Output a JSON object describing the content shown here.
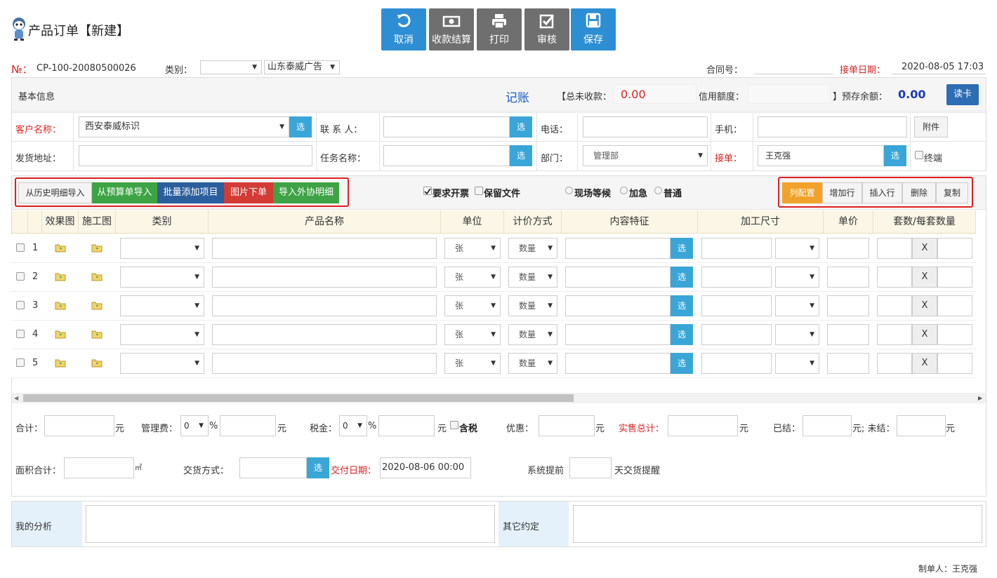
{
  "page": {
    "title": "产品订单【新建】"
  },
  "toolbar": {
    "cancel": "取消",
    "collect": "收款结算",
    "print": "打印",
    "audit": "审核",
    "save": "保存"
  },
  "top": {
    "no_label": "№：",
    "no_value": "CP-100-20080500026",
    "category_label": "类别：",
    "category_value": "",
    "company_value": "山东泰威广告",
    "contract_label": "合同号：",
    "contract_value": "",
    "date_label": "接单日期：",
    "date_value": "2020-08-05 17:03"
  },
  "basic": {
    "title": "基本信息",
    "bookkeep": "记账",
    "unpaid_label": "【总未收款：",
    "unpaid_value": "0.00",
    "credit_label": "信用额度：",
    "credit_value": "",
    "prepaid_label": "】预存余额：",
    "prepaid_value": "0.00",
    "read_card": "读卡",
    "customer_label": "客户名称：",
    "customer_value": "西安泰威标识",
    "contact_label": "联 系 人：",
    "contact_value": "",
    "phone_label": "电话：",
    "phone_value": "",
    "mobile_label": "手机：",
    "mobile_value": "",
    "attach": "附件",
    "address_label": "发货地址：",
    "address_value": "",
    "task_label": "任务名称：",
    "task_value": "",
    "dept_label": "部门：",
    "dept_value": "管理部",
    "taker_label": "接单：",
    "taker_value": "王克强",
    "terminal_label": "终端",
    "pick": "选"
  },
  "actions": {
    "from_history": "从历史明细导入",
    "from_budget": "从预算单导入",
    "batch_add": "批量添加项目",
    "image_order": "图片下单",
    "import_outsource": "导入外协明细",
    "need_invoice": "要求开票",
    "keep_file": "保留文件",
    "wait_onsite": "现场等候",
    "urgent": "加急",
    "normal": "普通",
    "col_config": "列配置",
    "add_row": "增加行",
    "insert_row": "插入行",
    "delete": "删除",
    "copy": "复制"
  },
  "grid": {
    "headers": [
      "效果图",
      "施工图",
      "类别",
      "产品名称",
      "单位",
      "计价方式",
      "内容特征",
      "加工尺寸",
      "单价",
      "套数/每套数量"
    ],
    "rows": [
      {
        "no": "1",
        "unit": "张",
        "pricing": "数量",
        "x": "X"
      },
      {
        "no": "2",
        "unit": "张",
        "pricing": "数量",
        "x": "X"
      },
      {
        "no": "3",
        "unit": "张",
        "pricing": "数量",
        "x": "X"
      },
      {
        "no": "4",
        "unit": "张",
        "pricing": "数量",
        "x": "X"
      },
      {
        "no": "5",
        "unit": "张",
        "pricing": "数量",
        "x": "X"
      }
    ],
    "pick": "选"
  },
  "totals": {
    "sum_label": "合计：",
    "yuan": "元",
    "mgmt_label": "管理费：",
    "mgmt_rate": "0",
    "percent": "%",
    "tax_label": "税金：",
    "tax_rate": "0",
    "tax_incl": "含税",
    "discount_label": "优惠：",
    "real_total_label": "实售总计：",
    "settled_label": "已结：",
    "unsettled_label": "元; 未结：",
    "area_label": "面积合计：",
    "area_unit": "㎡",
    "delivery_label": "交货方式：",
    "pick": "选",
    "due_label": "交付日期：",
    "due_value": "2020-08-06 00:00",
    "remind_label": "系统提前",
    "remind_suffix": "天交货提醒"
  },
  "notes": {
    "analysis_label": "我的分析",
    "other_label": "其它约定"
  },
  "footer": {
    "maker": "制单人：王克强"
  }
}
